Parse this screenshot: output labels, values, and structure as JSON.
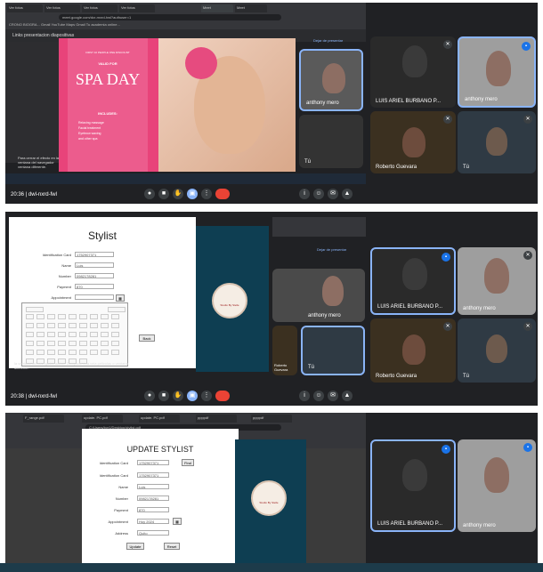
{
  "panel1": {
    "browser_tabs": [
      "Ver fotos",
      "Ver fotos",
      "Ver fotos",
      "Ver fotos",
      "Meet",
      "Meet",
      "Meet",
      "Meet"
    ],
    "url": "meet.google.com/dcr-mxrd-hwl?authuser=1",
    "bookmarks": "CRONO BIOGRA...   Gmail   YouTube   Maps   Gmail   Tu academia online...",
    "slides_title": "Links presentacion diapositivas",
    "spa_small": "FIRST 10 PEOPLE ONE DISCOUNT",
    "spa_valid": "VALID FOR",
    "spa_title": "SPA DAY",
    "spa_includes": "INCLUDES:",
    "spa_items": [
      "Relaxing massage",
      "Facial treatment",
      "Eyebrow waxing",
      "and other spa"
    ],
    "present_label": "Dejar de presentar",
    "meet_time": "20:36",
    "meet_code": "dwl-nxrd-fwl",
    "side_text": "Para cerrar el efecto en la ventana del navegador ventana diferente.",
    "tiles": [
      {
        "name": "LUIS ARIEL BURBANO P..."
      },
      {
        "name": "anthony mero"
      },
      {
        "name": "Roberto Guevara"
      },
      {
        "name": "Tú"
      }
    ],
    "thumb_labels": [
      "anthony mero",
      "Tú"
    ]
  },
  "panel2": {
    "form_title": "Stylist",
    "fields": [
      {
        "label": "Identification Card",
        "value": "1752907371"
      },
      {
        "label": "Name",
        "value": "Luis"
      },
      {
        "label": "Number",
        "value": "0982178281"
      },
      {
        "label": "Payment",
        "value": "870"
      },
      {
        "label": "Appointment",
        "value": ""
      }
    ],
    "back_label": "Back",
    "logo_text": "Studio By Stelle",
    "meet_time": "20:38",
    "meet_code": "dwl-nxrd-fwl",
    "present_label": "Dejar de presentar",
    "side_text": "la ventana del navegador activo. Comparte una vela peliculas o ventana diferente.",
    "tiles": [
      {
        "name": "LUIS ARIEL BURBANO P..."
      },
      {
        "name": "anthony mero"
      },
      {
        "name": "Roberto Guevara"
      },
      {
        "name": "Tú"
      }
    ],
    "thumb_labels": [
      "anthony mero",
      "Roberto Guevara",
      "Tú"
    ]
  },
  "panel3": {
    "pdf_tabs": [
      "F_range.pdf",
      "update. PC.pdf",
      "update. PC.pdf",
      "ppppdf",
      "ppppdf"
    ],
    "path": "C:/Users/byr1/Desktop/stylist.pdf",
    "form_title": "UPDATE STYLIST",
    "fields": [
      {
        "label": "Identification Card",
        "value": "1752907371"
      },
      {
        "label": "Identification Card",
        "value": "1752907371"
      },
      {
        "label": "Name",
        "value": "Luis"
      },
      {
        "label": "Number",
        "value": "0982178281"
      },
      {
        "label": "Payment",
        "value": "870"
      },
      {
        "label": "Appointment",
        "value": "Hoy 2024"
      },
      {
        "label": "Address",
        "value": "Quito"
      }
    ],
    "find_label": "Find",
    "update_label": "Update",
    "reset_label": "Reset",
    "logo_text": "Studio By Stelle",
    "tiles": [
      {
        "name": "LUIS ARIEL BURBANO P..."
      },
      {
        "name": "anthony mero"
      }
    ]
  },
  "colors": {
    "meet_bg": "#202124",
    "spa_pink": "#e8437a",
    "stylist_panel": "#0e3e52",
    "end_call": "#ea4335",
    "speaking": "#1a73e8"
  }
}
